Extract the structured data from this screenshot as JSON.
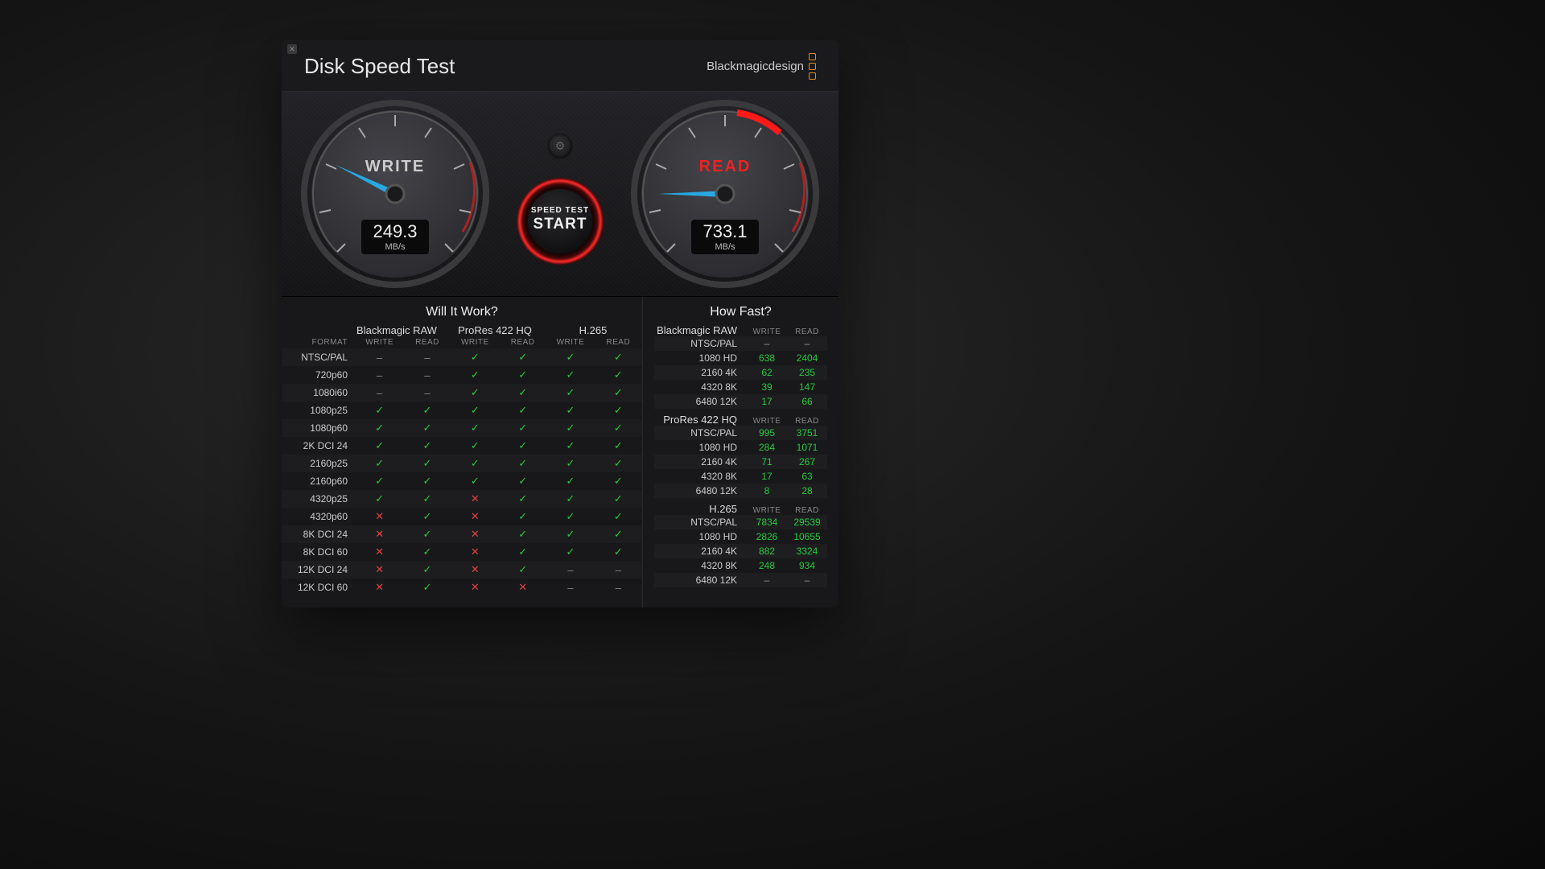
{
  "header": {
    "title": "Disk Speed Test",
    "brand": "Blackmagicdesign"
  },
  "gauges": {
    "write": {
      "label": "WRITE",
      "value": "249.3",
      "unit": "MB/s",
      "angle_deg": -154
    },
    "read": {
      "label": "READ",
      "value": "733.1",
      "unit": "MB/s",
      "angle_deg": -180
    }
  },
  "start_button": {
    "top_line": "SPEED TEST",
    "bottom_line": "START"
  },
  "will_it_work": {
    "title": "Will It Work?",
    "format_header": "FORMAT",
    "write_header": "WRITE",
    "read_header": "READ",
    "codecs": [
      "Blackmagic RAW",
      "ProRes 422 HQ",
      "H.265"
    ],
    "rows": [
      {
        "format": "NTSC/PAL",
        "cells": [
          "dash",
          "dash",
          "chk",
          "chk",
          "chk",
          "chk"
        ]
      },
      {
        "format": "720p60",
        "cells": [
          "dash",
          "dash",
          "chk",
          "chk",
          "chk",
          "chk"
        ]
      },
      {
        "format": "1080i60",
        "cells": [
          "dash",
          "dash",
          "chk",
          "chk",
          "chk",
          "chk"
        ]
      },
      {
        "format": "1080p25",
        "cells": [
          "chk",
          "chk",
          "chk",
          "chk",
          "chk",
          "chk"
        ]
      },
      {
        "format": "1080p60",
        "cells": [
          "chk",
          "chk",
          "chk",
          "chk",
          "chk",
          "chk"
        ]
      },
      {
        "format": "2K DCI 24",
        "cells": [
          "chk",
          "chk",
          "chk",
          "chk",
          "chk",
          "chk"
        ]
      },
      {
        "format": "2160p25",
        "cells": [
          "chk",
          "chk",
          "chk",
          "chk",
          "chk",
          "chk"
        ]
      },
      {
        "format": "2160p60",
        "cells": [
          "chk",
          "chk",
          "chk",
          "chk",
          "chk",
          "chk"
        ]
      },
      {
        "format": "4320p25",
        "cells": [
          "chk",
          "chk",
          "x",
          "chk",
          "chk",
          "chk"
        ]
      },
      {
        "format": "4320p60",
        "cells": [
          "x",
          "chk",
          "x",
          "chk",
          "chk",
          "chk"
        ]
      },
      {
        "format": "8K DCI 24",
        "cells": [
          "x",
          "chk",
          "x",
          "chk",
          "chk",
          "chk"
        ]
      },
      {
        "format": "8K DCI 60",
        "cells": [
          "x",
          "chk",
          "x",
          "chk",
          "chk",
          "chk"
        ]
      },
      {
        "format": "12K DCI 24",
        "cells": [
          "x",
          "chk",
          "x",
          "chk",
          "dash",
          "dash"
        ]
      },
      {
        "format": "12K DCI 60",
        "cells": [
          "x",
          "chk",
          "x",
          "x",
          "dash",
          "dash"
        ]
      }
    ]
  },
  "how_fast": {
    "title": "How Fast?",
    "write_header": "WRITE",
    "read_header": "READ",
    "groups": [
      {
        "name": "Blackmagic RAW",
        "rows": [
          {
            "name": "NTSC/PAL",
            "write": "–",
            "read": "–",
            "w_cls": "gray",
            "r_cls": "gray"
          },
          {
            "name": "1080 HD",
            "write": "638",
            "read": "2404",
            "w_cls": "green",
            "r_cls": "green"
          },
          {
            "name": "2160 4K",
            "write": "62",
            "read": "235",
            "w_cls": "green",
            "r_cls": "green"
          },
          {
            "name": "4320 8K",
            "write": "39",
            "read": "147",
            "w_cls": "green",
            "r_cls": "green"
          },
          {
            "name": "6480 12K",
            "write": "17",
            "read": "66",
            "w_cls": "green",
            "r_cls": "green"
          }
        ]
      },
      {
        "name": "ProRes 422 HQ",
        "rows": [
          {
            "name": "NTSC/PAL",
            "write": "995",
            "read": "3751",
            "w_cls": "green",
            "r_cls": "green"
          },
          {
            "name": "1080 HD",
            "write": "284",
            "read": "1071",
            "w_cls": "green",
            "r_cls": "green"
          },
          {
            "name": "2160 4K",
            "write": "71",
            "read": "267",
            "w_cls": "green",
            "r_cls": "green"
          },
          {
            "name": "4320 8K",
            "write": "17",
            "read": "63",
            "w_cls": "green",
            "r_cls": "green"
          },
          {
            "name": "6480 12K",
            "write": "8",
            "read": "28",
            "w_cls": "green",
            "r_cls": "green"
          }
        ]
      },
      {
        "name": "H.265",
        "rows": [
          {
            "name": "NTSC/PAL",
            "write": "7834",
            "read": "29539",
            "w_cls": "green",
            "r_cls": "green"
          },
          {
            "name": "1080 HD",
            "write": "2826",
            "read": "10655",
            "w_cls": "green",
            "r_cls": "green"
          },
          {
            "name": "2160 4K",
            "write": "882",
            "read": "3324",
            "w_cls": "green",
            "r_cls": "green"
          },
          {
            "name": "4320 8K",
            "write": "248",
            "read": "934",
            "w_cls": "green",
            "r_cls": "green"
          },
          {
            "name": "6480 12K",
            "write": "–",
            "read": "–",
            "w_cls": "gray",
            "r_cls": "gray"
          }
        ]
      }
    ]
  }
}
